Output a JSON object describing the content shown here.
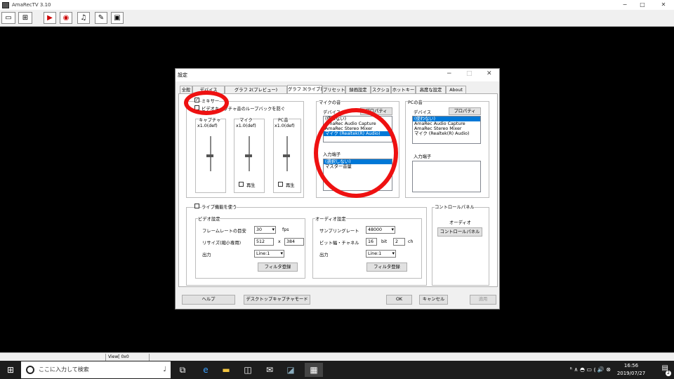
{
  "app": {
    "title": "AmaRecTV 3.10",
    "window_controls": [
      "−",
      "□",
      "✕"
    ]
  },
  "toolbar": {
    "buttons": [
      {
        "name": "settings-icon",
        "glyph": "▭"
      },
      {
        "name": "graph-icon",
        "glyph": "⊞"
      },
      {
        "name": "play-icon",
        "glyph": "▶"
      },
      {
        "name": "camera-icon",
        "glyph": "◉"
      },
      {
        "name": "music-icon",
        "glyph": "♫"
      },
      {
        "name": "edit-icon",
        "glyph": "✎"
      },
      {
        "name": "speaker-icon",
        "glyph": "▣"
      }
    ]
  },
  "dialog": {
    "title": "設定",
    "controls": [
      "−",
      "□",
      "✕"
    ],
    "tabs": [
      "全般",
      "デバイス",
      "グラフ 2(プレビュー)",
      "グラフ 3(ライブ)",
      "プリセット",
      "録画設定",
      "スクショ",
      "ホットキー",
      "高度な設定",
      "About"
    ],
    "active_tab": "グラフ 3(ライブ)",
    "mixer": {
      "checkbox_label": "ミキサー",
      "checked": true,
      "loopback_label": "ビデオキャプチャ音のループバックを防ぐ",
      "loopback_checked": false,
      "capture_label": "キャプチャ",
      "capture_value": "x1.0(def)",
      "mic_label": "マイク",
      "mic_value": "x1.0(def)",
      "pc_label": "PC音",
      "pc_value": "x1.0(def)",
      "play_label": "再生",
      "play_label2": "再生"
    },
    "mic_sound": {
      "group_label": "マイクの音",
      "device_label": "デバイス",
      "property_button": "プロパティ",
      "devices": [
        "(使わない)",
        "AmaRec Audio Capture",
        "AmaRec Stereo Mixer",
        "マイク (Realtek(R) Audio)"
      ],
      "selected_device": 3,
      "input_label": "入力端子",
      "inputs": [
        "(選択しない)",
        "マスター音量"
      ],
      "selected_input": 0
    },
    "pc_sound": {
      "group_label": "PCの音",
      "device_label": "デバイス",
      "property_button": "プロパティ",
      "devices": [
        "(使わない)",
        "AmaRec Audio Capture",
        "AmaRec Stereo Mixer",
        "マイク (Realtek(R) Audio)"
      ],
      "selected_device": 0,
      "input_label": "入力端子"
    },
    "live": {
      "checkbox_label": "ライブ機能を使う",
      "checked": false,
      "video": {
        "group_label": "ビデオ設定",
        "framerate_label": "フレームレートの目安",
        "framerate_value": "30",
        "fps_unit": "fps",
        "resize_label": "リサイズ(縮小専用)",
        "width": "512",
        "x_sep": "x",
        "height": "384",
        "output_label": "出力",
        "output_value": "Line:1",
        "filter_button": "フィルタ登録"
      },
      "audio": {
        "group_label": "オーディオ設定",
        "samplerate_label": "サンプリングレート",
        "samplerate_value": "48000",
        "bitch_label": "ビット幅・チャネル",
        "bit_value": "16",
        "bit_unit": "bit",
        "ch_value": "2",
        "ch_unit": "ch",
        "output_label": "出力",
        "output_value": "Line:1",
        "filter_button": "フィルタ登録"
      }
    },
    "control_panel": {
      "group_label": "コントロールパネル",
      "audio_label": "オーディオ",
      "button": "コントロールパネル"
    },
    "footer": {
      "help": "ヘルプ",
      "desktop_capture": "デスクトップキャプチャモード",
      "ok": "OK",
      "cancel": "キャンセル",
      "apply": "適用"
    }
  },
  "statusbar": {
    "view": "View[ 0x0 0.00fps]"
  },
  "taskbar": {
    "search_placeholder": "ここに入力して検索",
    "time": "16:56",
    "date": "2019/07/27",
    "tray_icons": "ᴿ ∧ ◓ ▭ ⦅ 🔊 ⊗",
    "notification_count": "2"
  },
  "colors": {
    "selection": "#0078d7",
    "annotation": "#e11111",
    "taskbar": "#1d1d1d"
  }
}
